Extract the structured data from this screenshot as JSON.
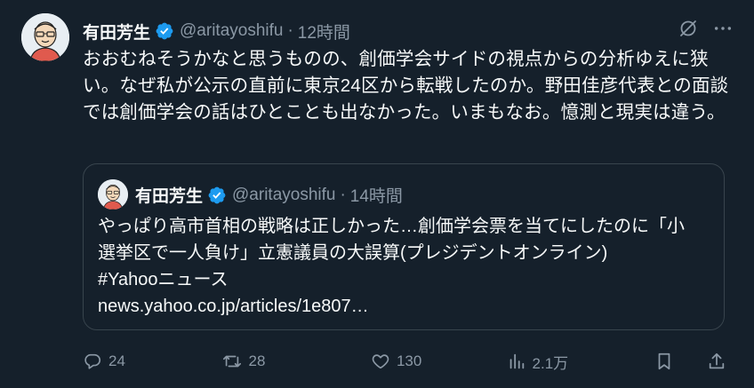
{
  "tweet": {
    "author_name": "有田芳生",
    "handle": "@aritayoshifu",
    "separator": "·",
    "time": "12時間",
    "text": "おおむねそうかなと思うものの、創価学会サイドの視点からの分析ゆえに狭い。なぜ私が公示の直前に東京24区から転戦したのか。野田佳彦代表との面談では創価学会の話はひとことも出なかった。いまもなお。憶測と現実は違う。"
  },
  "quote": {
    "author_name": "有田芳生",
    "handle": "@aritayoshifu",
    "separator": "·",
    "time": "14時間",
    "lines": [
      "やっぱり高市首相の戦略は正しかった…創価学会票を当てにしたのに「小",
      "選挙区で一人負け」立憲議員の大誤算(プレジデントオンライン)",
      "#Yahooニュース",
      "news.yahoo.co.jp/articles/1e807…"
    ]
  },
  "actions": {
    "replies": "24",
    "retweets": "28",
    "likes": "130",
    "views": "2.1万"
  },
  "icons": {
    "verified": "verified-badge-icon",
    "grok": "grok-icon",
    "more": "more-icon",
    "reply": "reply-icon",
    "retweet": "retweet-icon",
    "like": "heart-icon",
    "views": "views-icon",
    "bookmark": "bookmark-icon",
    "share": "share-icon"
  },
  "colors": {
    "background": "#15202b",
    "text": "#f7f9f9",
    "secondary": "#8b98a5",
    "verified": "#1d9bf0",
    "border": "#38444d"
  }
}
